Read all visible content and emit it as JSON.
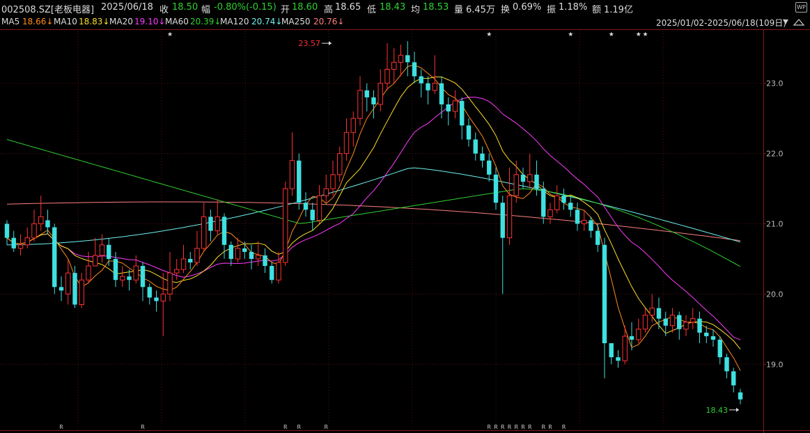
{
  "header": {
    "code": "002508.SZ[老板电器]",
    "date": "2025/06/18",
    "close_label": "收",
    "close_value": "18.50",
    "change_label": "幅",
    "change_value": "-0.80%(-0.15)",
    "open_label": "开",
    "open_value": "18.60",
    "high_label": "高",
    "high_value": "18.65",
    "low_label": "低",
    "low_value": "18.43",
    "avg_label": "均",
    "avg_value": "18.53",
    "vol_label": "量",
    "vol_value": "6.45万",
    "turnover_label": "换",
    "turnover_value": "0.69%",
    "amp_label": "振",
    "amp_value": "1.18%",
    "amount_label": "额",
    "amount_value": "1.19亿",
    "wp_icon_text": "WP"
  },
  "ma_bar": {
    "items": [
      {
        "name": "MA5",
        "value": "18.66↓",
        "color": "#ff8c1a"
      },
      {
        "name": "MA10",
        "value": "18.83↓",
        "color": "#ffdf2a"
      },
      {
        "name": "MA20",
        "value": "19.10↓",
        "color": "#ff3cff"
      },
      {
        "name": "MA60",
        "value": "20.39↓",
        "color": "#2fd12f"
      },
      {
        "name": "MA120",
        "value": "20.74↓",
        "color": "#6ff0f0"
      },
      {
        "name": "MA250",
        "value": "20.76↓",
        "color": "#ff7f7f"
      }
    ],
    "range": "2025/01/02-2025/06/18(109日)"
  },
  "chart_data": {
    "type": "candlestick",
    "ylim": [
      18.2,
      23.75
    ],
    "y_ticks": [
      "23.0",
      "22.0",
      "21.0",
      "20.0",
      "19.0"
    ],
    "y_tick_values": [
      23.0,
      22.0,
      21.0,
      20.0,
      19.0
    ],
    "up_color": "#ff3232",
    "down_color": "#3fe0e0",
    "annotations": {
      "high": {
        "label": "23.57",
        "index": 48,
        "value": 23.57,
        "color": "#ff3232"
      },
      "low": {
        "label": "18.43",
        "index": 108,
        "value": 18.43,
        "color": "#2fd12f"
      }
    },
    "candles": [
      [
        21.0,
        20.8,
        21.05,
        20.7
      ],
      [
        20.8,
        20.65,
        20.9,
        20.6
      ],
      [
        20.65,
        20.7,
        20.85,
        20.55
      ],
      [
        20.7,
        20.8,
        20.95,
        20.65
      ],
      [
        20.8,
        21.0,
        21.2,
        20.75
      ],
      [
        21.0,
        21.1,
        21.4,
        20.9
      ],
      [
        21.05,
        20.95,
        21.2,
        20.85
      ],
      [
        20.95,
        20.1,
        21.0,
        20.0
      ],
      [
        20.1,
        20.05,
        20.25,
        19.9
      ],
      [
        20.0,
        20.3,
        20.5,
        19.85
      ],
      [
        20.3,
        19.85,
        20.4,
        19.8
      ],
      [
        19.85,
        20.2,
        20.3,
        19.8
      ],
      [
        20.2,
        20.4,
        20.6,
        20.15
      ],
      [
        20.4,
        20.55,
        20.8,
        20.4
      ],
      [
        20.55,
        20.7,
        20.85,
        20.45
      ],
      [
        20.7,
        20.5,
        20.8,
        20.4
      ],
      [
        20.5,
        20.2,
        20.6,
        20.1
      ],
      [
        20.2,
        20.25,
        20.4,
        20.1
      ],
      [
        20.25,
        20.2,
        20.35,
        20.05
      ],
      [
        20.2,
        20.4,
        20.55,
        20.15
      ],
      [
        20.4,
        20.1,
        20.45,
        19.9
      ],
      [
        20.1,
        19.95,
        20.15,
        19.85
      ],
      [
        19.95,
        19.9,
        20.05,
        19.75
      ],
      [
        19.9,
        20.0,
        20.3,
        19.4
      ],
      [
        20.0,
        20.3,
        20.6,
        19.9
      ],
      [
        20.3,
        20.35,
        20.5,
        20.2
      ],
      [
        20.35,
        20.5,
        20.7,
        20.3
      ],
      [
        20.5,
        20.45,
        20.6,
        20.35
      ],
      [
        20.45,
        20.65,
        20.9,
        20.4
      ],
      [
        20.65,
        21.1,
        21.3,
        20.6
      ],
      [
        21.1,
        20.9,
        21.2,
        20.75
      ],
      [
        20.9,
        21.1,
        21.35,
        20.85
      ],
      [
        21.1,
        20.7,
        21.15,
        20.5
      ],
      [
        20.7,
        20.5,
        20.75,
        20.4
      ],
      [
        20.5,
        20.65,
        20.8,
        20.45
      ],
      [
        20.65,
        20.6,
        20.75,
        20.5
      ],
      [
        20.6,
        20.5,
        20.7,
        20.35
      ],
      [
        20.5,
        20.55,
        20.75,
        20.4
      ],
      [
        20.55,
        20.4,
        20.65,
        20.3
      ],
      [
        20.4,
        20.2,
        20.45,
        20.15
      ],
      [
        20.2,
        20.45,
        20.6,
        20.15
      ],
      [
        20.45,
        21.5,
        21.6,
        20.4
      ],
      [
        21.5,
        21.9,
        22.3,
        21.4
      ],
      [
        21.9,
        21.3,
        22.0,
        21.2
      ],
      [
        21.3,
        21.2,
        21.45,
        21.1
      ],
      [
        21.2,
        21.05,
        21.3,
        20.9
      ],
      [
        21.05,
        21.4,
        21.55,
        21.0
      ],
      [
        21.4,
        21.5,
        21.7,
        21.3
      ],
      [
        21.5,
        21.7,
        21.9,
        21.4
      ],
      [
        21.7,
        22.0,
        22.1,
        21.6
      ],
      [
        22.0,
        22.3,
        22.5,
        21.9
      ],
      [
        22.3,
        22.5,
        22.6,
        22.1
      ],
      [
        22.5,
        22.9,
        23.1,
        22.4
      ],
      [
        22.9,
        22.8,
        23.0,
        22.6
      ],
      [
        22.8,
        22.7,
        22.9,
        22.5
      ],
      [
        22.7,
        23.0,
        23.2,
        22.6
      ],
      [
        23.0,
        23.2,
        23.57,
        22.9
      ],
      [
        23.2,
        23.3,
        23.5,
        23.0
      ],
      [
        23.3,
        23.4,
        23.55,
        23.1
      ],
      [
        23.4,
        23.3,
        23.6,
        23.1
      ],
      [
        23.3,
        23.1,
        23.45,
        23.0
      ],
      [
        23.1,
        23.0,
        23.2,
        22.8
      ],
      [
        23.0,
        22.9,
        23.1,
        22.7
      ],
      [
        22.9,
        23.0,
        23.4,
        22.85
      ],
      [
        23.0,
        22.7,
        23.1,
        22.5
      ],
      [
        22.7,
        22.6,
        22.8,
        22.4
      ],
      [
        22.6,
        22.75,
        22.9,
        22.5
      ],
      [
        22.75,
        22.4,
        22.8,
        22.2
      ],
      [
        22.4,
        22.2,
        22.5,
        22.1
      ],
      [
        22.2,
        22.0,
        22.3,
        21.9
      ],
      [
        22.0,
        21.9,
        22.1,
        21.8
      ],
      [
        21.9,
        21.7,
        22.0,
        21.6
      ],
      [
        21.7,
        21.3,
        21.8,
        21.2
      ],
      [
        21.3,
        20.8,
        21.4,
        20.0
      ],
      [
        20.8,
        21.4,
        21.8,
        20.7
      ],
      [
        21.4,
        21.7,
        21.9,
        21.3
      ],
      [
        21.7,
        21.6,
        21.8,
        21.5
      ],
      [
        21.6,
        21.7,
        22.0,
        21.5
      ],
      [
        21.7,
        21.5,
        21.9,
        21.4
      ],
      [
        21.5,
        21.1,
        21.6,
        21.0
      ],
      [
        21.1,
        21.2,
        21.3,
        21.0
      ],
      [
        21.2,
        21.4,
        21.55,
        21.15
      ],
      [
        21.4,
        21.3,
        21.5,
        21.2
      ],
      [
        21.3,
        21.2,
        21.4,
        21.1
      ],
      [
        21.2,
        21.0,
        21.3,
        20.9
      ],
      [
        21.0,
        21.05,
        21.2,
        20.9
      ],
      [
        21.05,
        20.9,
        21.1,
        20.8
      ],
      [
        20.9,
        20.7,
        21.0,
        20.6
      ],
      [
        20.7,
        19.3,
        20.8,
        18.8
      ],
      [
        19.3,
        19.1,
        19.3,
        19.0
      ],
      [
        19.1,
        19.05,
        19.2,
        18.95
      ],
      [
        19.05,
        19.4,
        19.55,
        19.0
      ],
      [
        19.4,
        19.35,
        19.6,
        19.2
      ],
      [
        19.35,
        19.5,
        19.65,
        19.3
      ],
      [
        19.5,
        19.7,
        19.8,
        19.45
      ],
      [
        19.7,
        19.8,
        20.0,
        19.6
      ],
      [
        19.8,
        19.65,
        19.95,
        19.5
      ],
      [
        19.65,
        19.55,
        19.75,
        19.4
      ],
      [
        19.55,
        19.7,
        19.8,
        19.45
      ],
      [
        19.7,
        19.5,
        19.75,
        19.35
      ],
      [
        19.5,
        19.6,
        19.7,
        19.4
      ],
      [
        19.6,
        19.65,
        19.8,
        19.5
      ],
      [
        19.65,
        19.45,
        19.75,
        19.3
      ],
      [
        19.45,
        19.4,
        19.55,
        19.3
      ],
      [
        19.4,
        19.35,
        19.5,
        19.25
      ],
      [
        19.35,
        19.1,
        19.4,
        19.0
      ],
      [
        19.1,
        18.9,
        19.15,
        18.8
      ],
      [
        18.9,
        18.7,
        18.95,
        18.6
      ],
      [
        18.6,
        18.5,
        18.65,
        18.43
      ]
    ],
    "star_markers": [
      24,
      71,
      83,
      89,
      93,
      94
    ],
    "r_markers": [
      8,
      20,
      41,
      43,
      47,
      71,
      72,
      73,
      74,
      75,
      76,
      77,
      79,
      80,
      82
    ]
  }
}
